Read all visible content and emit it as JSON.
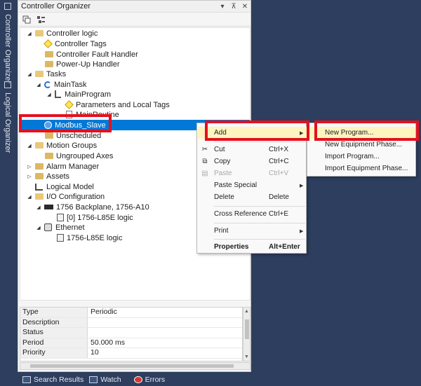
{
  "side_tabs": [
    {
      "label": "Controller Organizer",
      "icon": "controller-organizer-icon"
    },
    {
      "label": "Logical Organizer",
      "icon": "logical-organizer-icon"
    }
  ],
  "panel": {
    "title": "Controller Organizer",
    "title_buttons": [
      "▾",
      "⊼",
      "✕"
    ]
  },
  "tree": {
    "controller_logic": "Controller logic",
    "controller_tags": "Controller Tags",
    "controller_fault_handler": "Controller Fault Handler",
    "power_up_handler": "Power-Up Handler",
    "tasks": "Tasks",
    "main_task": "MainTask",
    "main_program": "MainProgram",
    "parameters_local_tags": "Parameters and Local Tags",
    "main_routine": "MainRoutine",
    "modbus_slave": "Modbus_Slave",
    "unscheduled": "Unscheduled",
    "motion_groups": "Motion Groups",
    "ungrouped_axes": "Ungrouped Axes",
    "alarm_manager": "Alarm Manager",
    "assets": "Assets",
    "logical_model": "Logical Model",
    "io_configuration": "I/O Configuration",
    "backplane": "1756 Backplane, 1756-A10",
    "slot0_module": "[0] 1756-L85E logic",
    "ethernet": "Ethernet",
    "eth_module": "1756-L85E logic"
  },
  "properties": [
    {
      "key": "Type",
      "value": "Periodic"
    },
    {
      "key": "Description",
      "value": ""
    },
    {
      "key": "Status",
      "value": ""
    },
    {
      "key": "Period",
      "value": "50.000 ms"
    },
    {
      "key": "Priority",
      "value": "10"
    }
  ],
  "context_menu": {
    "add": "Add",
    "cut": "Cut",
    "cut_shortcut": "Ctrl+X",
    "copy": "Copy",
    "copy_shortcut": "Ctrl+C",
    "paste": "Paste",
    "paste_shortcut": "Ctrl+V",
    "paste_special": "Paste Special",
    "delete": "Delete",
    "delete_shortcut": "Delete",
    "cross_reference": "Cross Reference",
    "cross_reference_shortcut": "Ctrl+E",
    "print": "Print",
    "properties": "Properties",
    "properties_shortcut": "Alt+Enter"
  },
  "submenu": {
    "new_program": "New Program...",
    "new_equipment_phase": "New Equipment Phase...",
    "import_program": "Import Program...",
    "import_equipment_phase": "Import Equipment Phase..."
  },
  "bottom_tabs": {
    "search_results": "Search Results",
    "watch": "Watch",
    "errors": "Errors"
  },
  "colors": {
    "workspace": "#2d3e5e",
    "selection": "#0078d7",
    "menu_highlight": "#fdf4bf",
    "callout_red": "#e4101e"
  }
}
